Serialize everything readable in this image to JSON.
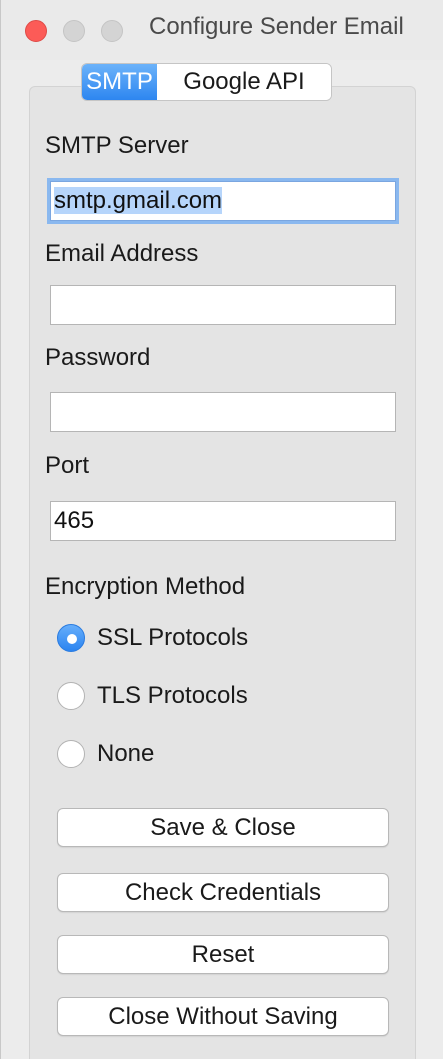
{
  "window": {
    "title": "Configure Sender Email"
  },
  "tabs": [
    {
      "label": "SMTP",
      "active": true
    },
    {
      "label": "Google API",
      "active": false
    }
  ],
  "form": {
    "smtp_server": {
      "label": "SMTP Server",
      "value": "smtp.gmail.com"
    },
    "email": {
      "label": "Email Address",
      "value": ""
    },
    "password": {
      "label": "Password",
      "value": ""
    },
    "port": {
      "label": "Port",
      "value": "465"
    }
  },
  "encryption": {
    "label": "Encryption Method",
    "options": [
      {
        "label": "SSL Protocols",
        "selected": true
      },
      {
        "label": "TLS Protocols",
        "selected": false
      },
      {
        "label": "None",
        "selected": false
      }
    ]
  },
  "buttons": {
    "save_close": "Save & Close",
    "check_credentials": "Check Credentials",
    "reset": "Reset",
    "close_without_saving": "Close Without Saving"
  },
  "colors": {
    "accent": "#2d86f0",
    "close": "#fc5b57"
  }
}
